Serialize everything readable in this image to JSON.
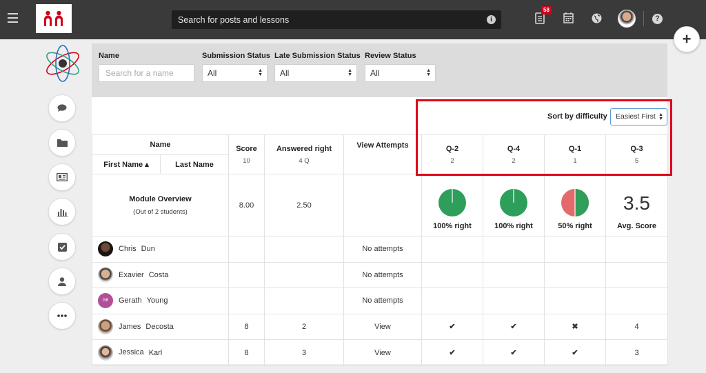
{
  "topbar": {
    "search_placeholder": "Search for posts and lessons",
    "notification_count": "58"
  },
  "filters": {
    "name_label": "Name",
    "name_placeholder": "Search for a name",
    "submission_label": "Submission Status",
    "submission_value": "All",
    "late_label": "Late Submission Status",
    "late_value": "All",
    "review_label": "Review Status",
    "review_value": "All"
  },
  "sort": {
    "label": "Sort by difficulty",
    "value": "Easiest First"
  },
  "table": {
    "name_header": "Name",
    "first_name_header": "First Name ▴",
    "last_name_header": "Last Name",
    "score_header": "Score",
    "score_sub": "10",
    "answered_header": "Answered right",
    "answered_sub": "4 Q",
    "attempts_header": "View Attempts",
    "questions": [
      {
        "label": "Q-2",
        "sub": "2"
      },
      {
        "label": "Q-4",
        "sub": "2"
      },
      {
        "label": "Q-1",
        "sub": "1"
      },
      {
        "label": "Q-3",
        "sub": "5"
      }
    ],
    "overview": {
      "title": "Module Overview",
      "subtitle": "(Out of 2 students)",
      "score": "8.00",
      "answered": "2.50",
      "q2_label": "100% right",
      "q2_fraction": 1.0,
      "q4_label": "100% right",
      "q4_fraction": 1.0,
      "q1_label": "50% right",
      "q1_fraction": 0.5,
      "q3_avg": "3.5",
      "q3_label": "Avg. Score"
    },
    "rows": [
      {
        "first": "Chris",
        "last": "Dun",
        "score": "",
        "answered": "",
        "attempts": "No attempts",
        "q2": "",
        "q4": "",
        "q1": "",
        "q3": "",
        "initials": ""
      },
      {
        "first": "Exavier",
        "last": "Costa",
        "score": "",
        "answered": "",
        "attempts": "No attempts",
        "q2": "",
        "q4": "",
        "q1": "",
        "q3": "",
        "initials": ""
      },
      {
        "first": "Gerath",
        "last": "Young",
        "score": "",
        "answered": "",
        "attempts": "No attempts",
        "q2": "",
        "q4": "",
        "q1": "",
        "q3": "",
        "initials": "GB"
      },
      {
        "first": "James",
        "last": "Decosta",
        "score": "8",
        "answered": "2",
        "attempts": "View",
        "q2": "✔",
        "q4": "✔",
        "q1": "✖",
        "q3": "4",
        "initials": ""
      },
      {
        "first": "Jessica",
        "last": "Karl",
        "score": "8",
        "answered": "3",
        "attempts": "View",
        "q2": "✔",
        "q4": "✔",
        "q1": "✔",
        "q3": "3",
        "initials": ""
      }
    ]
  },
  "colors": {
    "correct": "#2e9e5b",
    "wrong": "#e26a6a",
    "highlight": "#e0001b",
    "topbar": "#3a3a3a"
  },
  "icons": [
    "menu-icon",
    "info-icon",
    "document-icon",
    "calendar-icon",
    "globe-icon",
    "help-icon",
    "plus-icon",
    "chat-icon",
    "folder-icon",
    "news-icon",
    "bar-chart-icon",
    "checkbox-icon",
    "person-icon",
    "more-icon"
  ]
}
